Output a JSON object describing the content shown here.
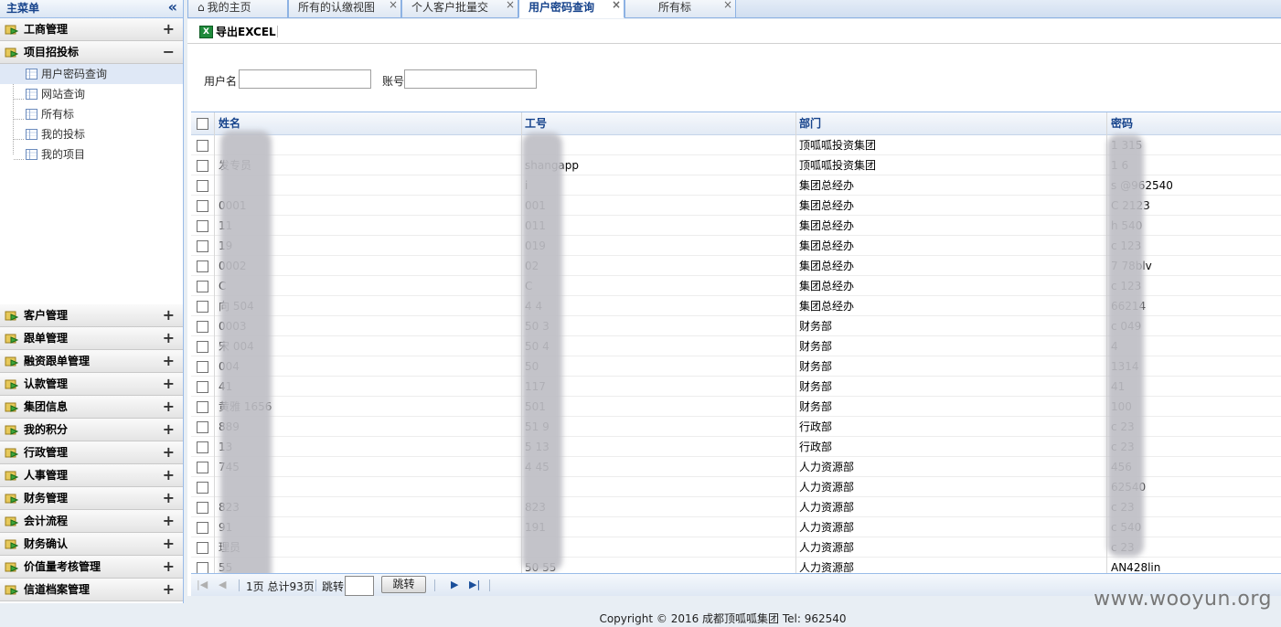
{
  "sidebar": {
    "title": "主菜单",
    "collapse_glyph": "«",
    "sections": [
      {
        "label": "工商管理",
        "expanded": false
      },
      {
        "label": "项目招投标",
        "expanded": true
      }
    ],
    "tree_items": [
      {
        "label": "用户密码查询",
        "selected": true
      },
      {
        "label": "网站查询"
      },
      {
        "label": "所有标"
      },
      {
        "label": "我的投标"
      },
      {
        "label": "我的项目"
      }
    ],
    "lower_sections": [
      "客户管理",
      "跟单管理",
      "融资跟单管理",
      "认款管理",
      "集团信息",
      "我的积分",
      "行政管理",
      "人事管理",
      "财务管理",
      "会计流程",
      "财务确认",
      "价值量考核管理",
      "信道档案管理"
    ],
    "plus_glyph": "+",
    "minus_glyph": "−"
  },
  "tabs": [
    {
      "label": "我的主页",
      "icon": "home-icon",
      "active": false,
      "closable": false
    },
    {
      "label": "所有的认缴视图",
      "active": false,
      "closable": true
    },
    {
      "label": "个人客户批量交",
      "active": false,
      "closable": true
    },
    {
      "label": "用户密码查询",
      "active": true,
      "closable": true
    },
    {
      "label": "所有标",
      "active": false,
      "closable": true
    }
  ],
  "close_glyph": "×",
  "toolbar": {
    "export_label": "导出EXCEL",
    "export_icon": "excel-icon"
  },
  "search": {
    "username_label": "用户名",
    "username_value": "",
    "account_label": "账号",
    "account_value": ""
  },
  "grid": {
    "columns": [
      "姓名",
      "工号",
      "部门",
      "密码"
    ],
    "rows": [
      [
        "",
        "",
        "顶呱呱投资集团",
        "1      315"
      ],
      [
        "          发专员",
        "      shangapp",
        "顶呱呱投资集团",
        "1      6"
      ],
      [
        "",
        "      i",
        "集团总经办",
        "s      @962540"
      ],
      [
        "          0001",
        "      001",
        "集团总经办",
        "C      2123"
      ],
      [
        "          11",
        "      011",
        "集团总经办",
        "h      540"
      ],
      [
        "          19",
        "      019",
        "集团总经办",
        "c      123"
      ],
      [
        "          0002",
        "      02",
        "集团总经办",
        "7      78blv"
      ],
      [
        "C",
        "C",
        "集团总经办",
        "c      123"
      ],
      [
        "向        504",
        "4      4",
        "集团总经办",
        "       66214"
      ],
      [
        "          0003",
        "50     3",
        "财务部",
        "c      049"
      ],
      [
        "宋        004",
        "50     4",
        "财务部",
        "       4"
      ],
      [
        "          004",
        "50",
        "财务部",
        "       1314"
      ],
      [
        "          41",
        "117",
        "财务部",
        "       41"
      ],
      [
        "黄雅      1656",
        "501",
        "财务部",
        "       100"
      ],
      [
        "          889",
        "51     9",
        "行政部",
        "c      23"
      ],
      [
        "          13",
        "5      13",
        "行政部",
        "c      23"
      ],
      [
        "          745",
        "4      45",
        "人力资源部",
        "       456"
      ],
      [
        "",
        "",
        "人力资源部",
        "       62540"
      ],
      [
        "          823",
        "       823",
        "人力资源部",
        "c      23"
      ],
      [
        "          91",
        "       191",
        "人力资源部",
        "c      540"
      ],
      [
        "          理员",
        "",
        "人力资源部",
        "c      23"
      ],
      [
        "          55",
        "50     55",
        "人力资源部",
        "       AN428lin"
      ]
    ]
  },
  "pager": {
    "page_info": "1页 总计93页",
    "jump_label": "跳转",
    "jump_value": "",
    "goto_button": "跳转"
  },
  "footer": "Copyright © 2016 成都顶呱呱集团 Tel: 962540",
  "watermark": "www.wooyun.org",
  "colors": {
    "accent": "#15428b",
    "border": "#99bbe8",
    "excel": "#1f8a3b"
  }
}
